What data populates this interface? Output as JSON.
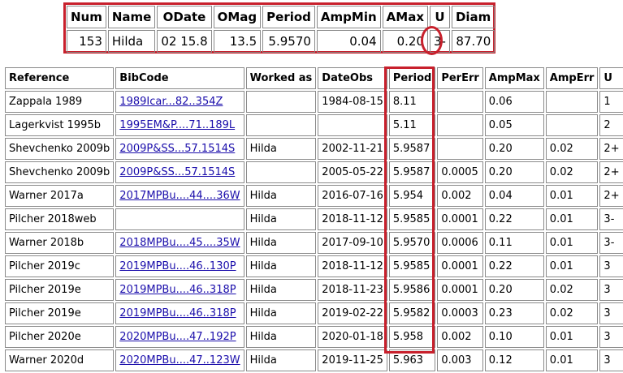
{
  "summary": {
    "headers": [
      "Num",
      "Name",
      "ODate",
      "OMag",
      "Period",
      "AmpMin",
      "AMax",
      "U",
      "Diam"
    ],
    "row": {
      "num": "153",
      "name": "Hilda",
      "odate": "02 15.8",
      "omag": "13.5",
      "period": "5.9570",
      "ampmin": "0.04",
      "amax": "0.20",
      "u": "3-",
      "diam": "87.70"
    }
  },
  "main": {
    "headers": [
      "Reference",
      "BibCode",
      "Worked as",
      "DateObs",
      "Period",
      "PerErr",
      "AmpMax",
      "AmpErr",
      "U"
    ],
    "rows": [
      {
        "reference": "Zappala 1989",
        "bibcode": "1989Icar...82..354Z",
        "worked_as": "",
        "dateobs": "1984-08-15",
        "period": "8.11",
        "pererr": "",
        "ampmax": "0.06",
        "amperr": "",
        "u": "1"
      },
      {
        "reference": "Lagerkvist 1995b",
        "bibcode": "1995EM&P....71..189L",
        "worked_as": "",
        "dateobs": "",
        "period": "5.11",
        "pererr": "",
        "ampmax": "0.05",
        "amperr": "",
        "u": "2"
      },
      {
        "reference": "Shevchenko 2009b",
        "bibcode": "2009P&SS...57.1514S",
        "worked_as": "Hilda",
        "dateobs": "2002-11-21",
        "period": "5.9587",
        "pererr": "",
        "ampmax": "0.20",
        "amperr": "0.02",
        "u": "2+"
      },
      {
        "reference": "Shevchenko 2009b",
        "bibcode": "2009P&SS...57.1514S",
        "worked_as": "",
        "dateobs": "2005-05-22",
        "period": "5.9587",
        "pererr": "0.0005",
        "ampmax": "0.20",
        "amperr": "0.02",
        "u": "2+"
      },
      {
        "reference": "Warner 2017a",
        "bibcode": "2017MPBu....44....36W",
        "worked_as": "Hilda",
        "dateobs": "2016-07-16",
        "period": "5.954",
        "pererr": "0.002",
        "ampmax": "0.04",
        "amperr": "0.01",
        "u": "2+"
      },
      {
        "reference": "Pilcher 2018web",
        "bibcode": "",
        "worked_as": "Hilda",
        "dateobs": "2018-11-12",
        "period": "5.9585",
        "pererr": "0.0001",
        "ampmax": "0.22",
        "amperr": "0.01",
        "u": "3-"
      },
      {
        "reference": "Warner 2018b",
        "bibcode": "2018MPBu....45....35W",
        "worked_as": "Hilda",
        "dateobs": "2017-09-10",
        "period": "5.9570",
        "pererr": "0.0006",
        "ampmax": "0.11",
        "amperr": "0.01",
        "u": "3-"
      },
      {
        "reference": "Pilcher 2019c",
        "bibcode": "2019MPBu....46..130P",
        "worked_as": "Hilda",
        "dateobs": "2018-11-12",
        "period": "5.9585",
        "pererr": "0.0001",
        "ampmax": "0.22",
        "amperr": "0.01",
        "u": "3"
      },
      {
        "reference": "Pilcher 2019e",
        "bibcode": "2019MPBu....46..318P",
        "worked_as": "Hilda",
        "dateobs": "2018-11-23",
        "period": "5.9586",
        "pererr": "0.0001",
        "ampmax": "0.20",
        "amperr": "0.02",
        "u": "3"
      },
      {
        "reference": "Pilcher 2019e",
        "bibcode": "2019MPBu....46..318P",
        "worked_as": "Hilda",
        "dateobs": "2019-02-22",
        "period": "5.9582",
        "pererr": "0.0003",
        "ampmax": "0.23",
        "amperr": "0.02",
        "u": "3"
      },
      {
        "reference": "Pilcher 2020e",
        "bibcode": "2020MPBu....47..192P",
        "worked_as": "Hilda",
        "dateobs": "2020-01-18",
        "period": "5.958",
        "pererr": "0.002",
        "ampmax": "0.10",
        "amperr": "0.01",
        "u": "3"
      },
      {
        "reference": "Warner 2020d",
        "bibcode": "2020MPBu....47..123W",
        "worked_as": "Hilda",
        "dateobs": "2019-11-25",
        "period": "5.963",
        "pererr": "0.003",
        "ampmax": "0.12",
        "amperr": "0.01",
        "u": "3"
      }
    ]
  },
  "highlight_color": "#c8202c",
  "link_color": "#1a0dab"
}
